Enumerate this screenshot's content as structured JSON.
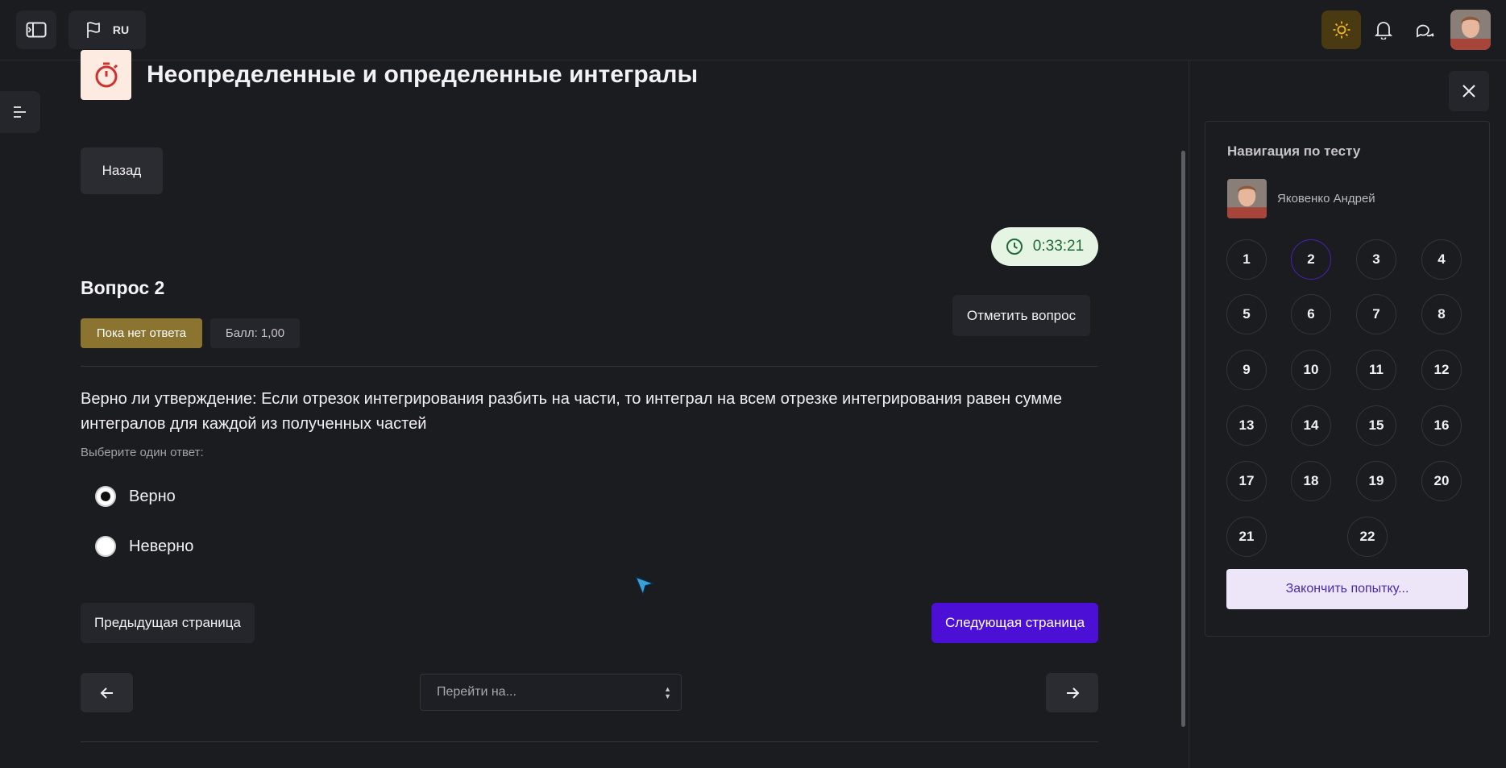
{
  "topbar": {
    "lang_code": "RU",
    "icons": [
      "sidebar-toggle-icon",
      "flag-icon",
      "sun-icon",
      "bell-icon",
      "chat-icon",
      "avatar"
    ],
    "theme_accent": "#4a3a12"
  },
  "main": {
    "title": "Неопределенные и определенные интегралы",
    "back_label": "Назад",
    "timer": "0:33:21",
    "question_title": "Вопрос 2",
    "status_badge": "Пока нет ответа",
    "score_badge": "Балл: 1,00",
    "flag_label": "Отметить вопрос",
    "question_text": "Верно ли утверждение: Если отрезок интегрирования разбить на части, то интеграл на всем отрезке интегрирования равен сумме интегралов для каждой из полученных частей",
    "answer_hint": "Выберите один ответ:",
    "options": [
      {
        "label": "Верно",
        "checked": true
      },
      {
        "label": "Неверно",
        "checked": false
      }
    ],
    "prev_label": "Предыдущая страница",
    "next_label": "Следующая страница",
    "jump_placeholder": "Перейти на...",
    "colors": {
      "next_button": "#4b0fd6",
      "status_badge": "#8b7430",
      "timer_bg": "#e6f4e4",
      "timer_text": "#1f6a3a"
    }
  },
  "nav": {
    "title": "Навигация по тесту",
    "user_name": "Яковенко Андрей",
    "questions": [
      "1",
      "2",
      "3",
      "4",
      "5",
      "6",
      "7",
      "8",
      "9",
      "10",
      "11",
      "12",
      "13",
      "14",
      "15",
      "16",
      "17",
      "18",
      "19",
      "20",
      "21",
      "22"
    ],
    "current": "2",
    "finish_label": "Закончить попытку..."
  }
}
